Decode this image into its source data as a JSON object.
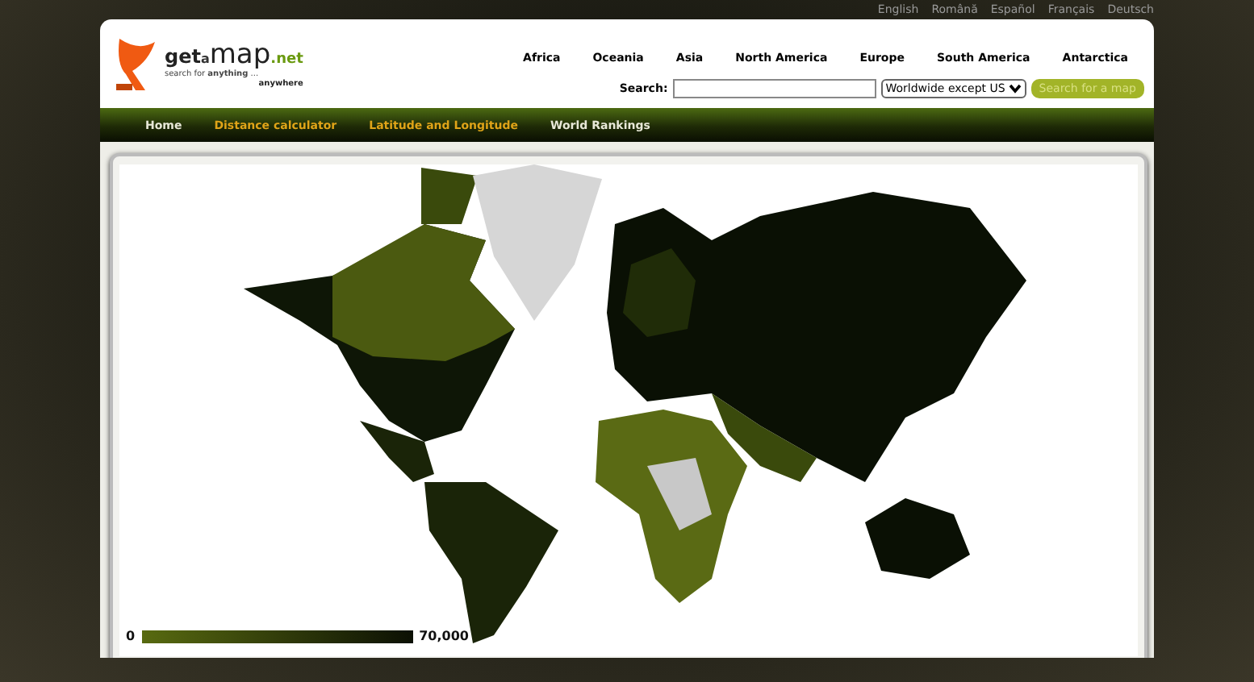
{
  "languages": [
    "English",
    "Română",
    "Español",
    "Français",
    "Deutsch"
  ],
  "logo": {
    "name_main": "get",
    "name_small": "a",
    "name_map": "map",
    "name_tld": ".net",
    "tagline_1": "search for **anything** ...",
    "tagline_2": "anywhere"
  },
  "continents": [
    "Africa",
    "Oceania",
    "Asia",
    "North America",
    "Europe",
    "South America",
    "Antarctica"
  ],
  "search": {
    "label": "Search:",
    "scope": "Worldwide except US",
    "button": "Search for a map"
  },
  "nav": [
    {
      "label": "Home",
      "color": "#e8e8d8"
    },
    {
      "label": "Distance calculator",
      "color": "#e0a418"
    },
    {
      "label": "Latitude and Longitude",
      "color": "#e0a418"
    },
    {
      "label": "World Rankings",
      "color": "#e8e8d8"
    }
  ],
  "legend": {
    "min": "0",
    "max": "70,000"
  }
}
